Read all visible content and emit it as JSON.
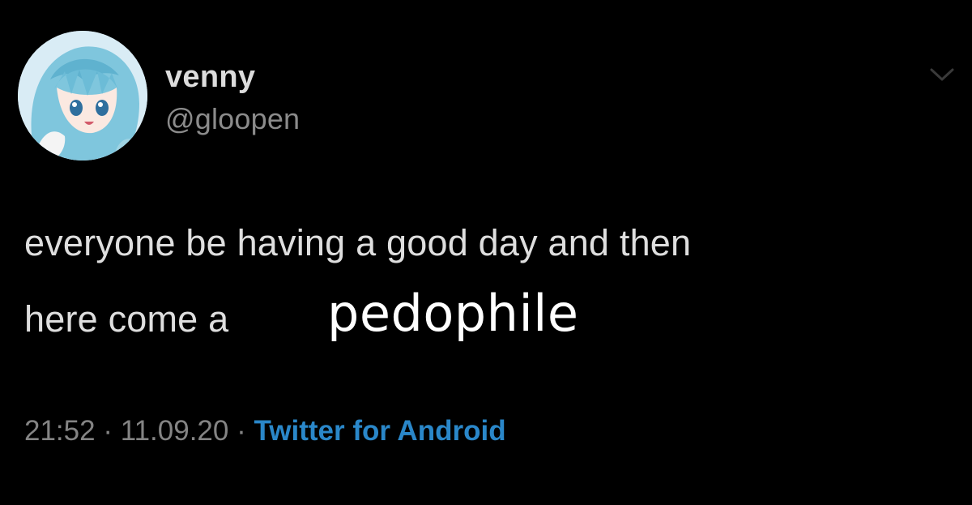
{
  "user": {
    "display_name": "venny",
    "handle": "@gloopen",
    "avatar_icon": "anime-girl-avatar"
  },
  "menu": {
    "icon": "chevron-down-icon"
  },
  "tweet": {
    "line1": "everyone be having a good day and then",
    "line2_prefix": "here come a",
    "overlay_word": "pedophile"
  },
  "meta": {
    "time": "21:52",
    "separator1": "·",
    "date": "11.09.20",
    "separator2": "·",
    "source": "Twitter for Android"
  },
  "colors": {
    "background": "#000000",
    "text": "#dedede",
    "muted": "#848484",
    "link": "#2a87c9",
    "overlay": "#ffffff"
  }
}
